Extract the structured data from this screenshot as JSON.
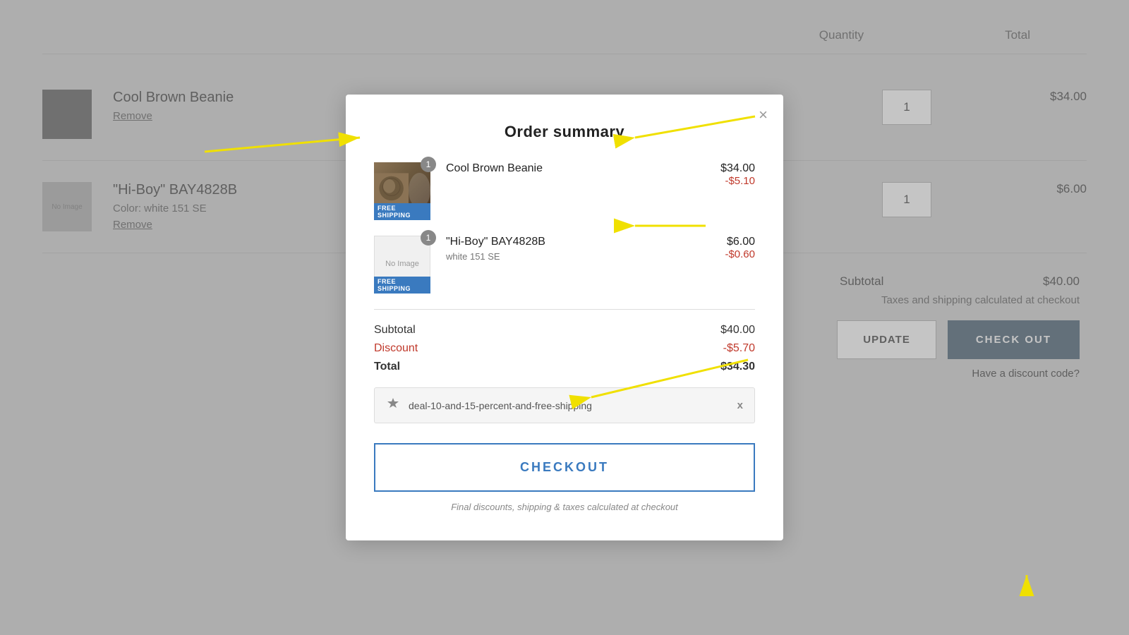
{
  "page": {
    "background_color": "#d0d0d0"
  },
  "background": {
    "header": {
      "quantity_label": "Quantity",
      "total_label": "Total"
    },
    "products": [
      {
        "name": "Cool Brown Beanie",
        "remove_label": "Remove",
        "quantity": "1",
        "price": "$34.00"
      },
      {
        "name": "\"Hi-Boy\" BAY4828B",
        "color": "Color: white 151 SE",
        "remove_label": "Remove",
        "quantity": "1",
        "price": "$6.00"
      }
    ],
    "subtotal_section": {
      "subtotal_label": "Subtotal",
      "subtotal_value": "$40.00",
      "tax_note": "Taxes and shipping calculated at checkout"
    },
    "buttons": {
      "update_label": "UPDATE",
      "checkout_label": "CHECK OUT"
    },
    "discount_link": "Have a discount code?"
  },
  "modal": {
    "title": "Order summary",
    "close_label": "×",
    "items": [
      {
        "id": "item-1",
        "name": "Cool Brown Beanie",
        "variant": null,
        "quantity_badge": "1",
        "price_original": "$34.00",
        "price_discount": "-$5.10",
        "has_free_shipping": true,
        "free_shipping_label": "FREE SHIPPING",
        "has_image": true
      },
      {
        "id": "item-2",
        "name": "\"Hi-Boy\" BAY4828B",
        "variant": "white 151 SE",
        "quantity_badge": "1",
        "price_original": "$6.00",
        "price_discount": "-$0.60",
        "has_free_shipping": true,
        "free_shipping_label": "FREE SHIPPING",
        "has_image": false
      }
    ],
    "totals": {
      "subtotal_label": "Subtotal",
      "subtotal_value": "$40.00",
      "discount_label": "Discount",
      "discount_value": "-$5.70",
      "total_label": "Total",
      "total_value": "$34.30"
    },
    "coupon": {
      "code": "deal-10-and-15-percent-and-free-shipping",
      "remove_label": "x"
    },
    "checkout_button_label": "CHECKOUT",
    "checkout_note": "Final discounts, shipping & taxes calculated at checkout"
  }
}
